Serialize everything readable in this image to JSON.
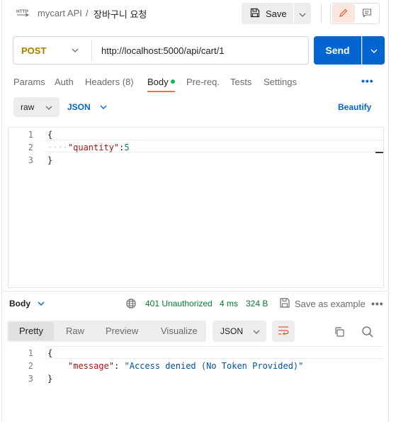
{
  "header": {
    "collection": "mycart API",
    "separator": "/",
    "title": "장바구니 요청",
    "save_label": "Save"
  },
  "request": {
    "method": "POST",
    "url": "http://localhost:5000/api/cart/1",
    "send_label": "Send"
  },
  "request_tabs": [
    {
      "label": "Params"
    },
    {
      "label": "Auth"
    },
    {
      "label": "Headers (8)"
    },
    {
      "label": "Body"
    },
    {
      "label": "Pre-req."
    },
    {
      "label": "Tests"
    },
    {
      "label": "Settings"
    }
  ],
  "more_label": "•••",
  "body_mode": {
    "type": "raw",
    "format": "JSON",
    "beautify_label": "Beautify"
  },
  "request_body": {
    "lines": [
      "1",
      "2",
      "3"
    ],
    "open_brace": "{",
    "key": "\"quantity\"",
    "colon": ":",
    "value": "5",
    "close_brace": "}"
  },
  "response": {
    "body_label": "Body",
    "status": "401 Unauthorized",
    "time": "4 ms",
    "size": "324 B",
    "save_example_label": "Save as example",
    "more_label": "•••",
    "view_tabs": [
      {
        "label": "Pretty"
      },
      {
        "label": "Raw"
      },
      {
        "label": "Preview"
      },
      {
        "label": "Visualize"
      }
    ],
    "format": "JSON",
    "lines": [
      "1",
      "2",
      "3"
    ],
    "open_brace": "{",
    "key": "\"message\"",
    "colon": ":",
    "value": "\"Access denied (No Token Provided)\"",
    "close_brace": "}"
  },
  "colors": {
    "accent": "#ff6c37",
    "primary": "#0265d2",
    "method_post": "#ad7a03",
    "status_ok": "#007f31"
  },
  "icons": [
    "http-icon",
    "save-icon",
    "chevron-down-icon",
    "pencil-icon",
    "comment-icon",
    "globe-icon",
    "wrap-lines-icon",
    "copy-icon",
    "search-icon"
  ]
}
